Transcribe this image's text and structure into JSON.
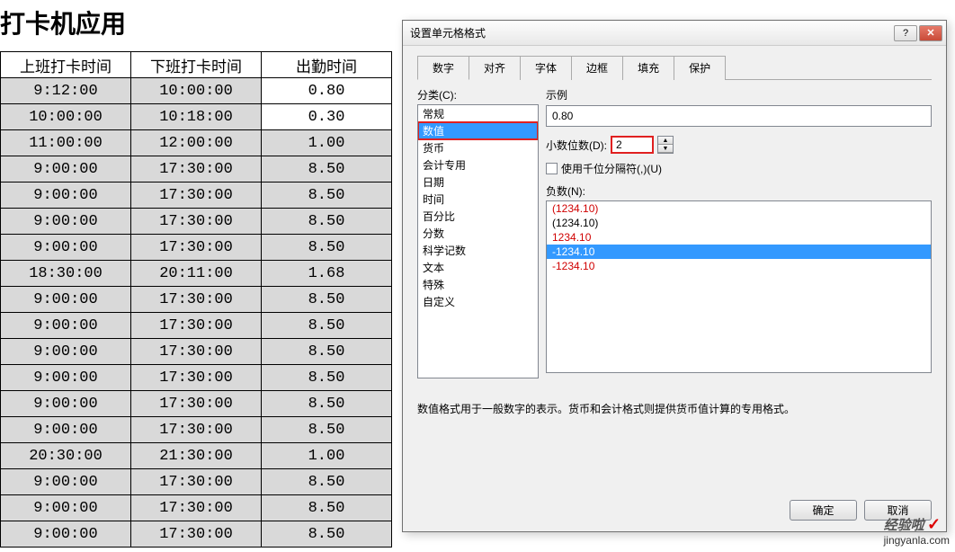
{
  "title": "打卡机应用",
  "table": {
    "headers": [
      "上班打卡时间",
      "下班打卡时间",
      "出勤时间"
    ],
    "rows": [
      [
        "9:12:00",
        "10:00:00",
        "0.80"
      ],
      [
        "10:00:00",
        "10:18:00",
        "0.30"
      ],
      [
        "11:00:00",
        "12:00:00",
        "1.00"
      ],
      [
        "9:00:00",
        "17:30:00",
        "8.50"
      ],
      [
        "9:00:00",
        "17:30:00",
        "8.50"
      ],
      [
        "9:00:00",
        "17:30:00",
        "8.50"
      ],
      [
        "9:00:00",
        "17:30:00",
        "8.50"
      ],
      [
        "18:30:00",
        "20:11:00",
        "1.68"
      ],
      [
        "9:00:00",
        "17:30:00",
        "8.50"
      ],
      [
        "9:00:00",
        "17:30:00",
        "8.50"
      ],
      [
        "9:00:00",
        "17:30:00",
        "8.50"
      ],
      [
        "9:00:00",
        "17:30:00",
        "8.50"
      ],
      [
        "9:00:00",
        "17:30:00",
        "8.50"
      ],
      [
        "9:00:00",
        "17:30:00",
        "8.50"
      ],
      [
        "20:30:00",
        "21:30:00",
        "1.00"
      ],
      [
        "9:00:00",
        "17:30:00",
        "8.50"
      ],
      [
        "9:00:00",
        "17:30:00",
        "8.50"
      ],
      [
        "9:00:00",
        "17:30:00",
        "8.50"
      ]
    ]
  },
  "dialog": {
    "title": "设置单元格格式",
    "help_symbol": "?",
    "close_symbol": "✕",
    "tabs": [
      "数字",
      "对齐",
      "字体",
      "边框",
      "填充",
      "保护"
    ],
    "active_tab_idx": 0,
    "category_label": "分类(C):",
    "categories": [
      "常规",
      "数值",
      "货币",
      "会计专用",
      "日期",
      "时间",
      "百分比",
      "分数",
      "科学记数",
      "文本",
      "特殊",
      "自定义"
    ],
    "selected_category_idx": 1,
    "example_label": "示例",
    "example_value": "0.80",
    "decimal_label": "小数位数(D):",
    "decimal_value": "2",
    "thousands_label": "使用千位分隔符(,)(U)",
    "negative_label": "负数(N):",
    "negatives": [
      {
        "text": "(1234.10)",
        "red": true
      },
      {
        "text": "(1234.10)",
        "red": false
      },
      {
        "text": "1234.10",
        "red": true
      },
      {
        "text": "-1234.10",
        "red": false,
        "selected": true
      },
      {
        "text": "-1234.10",
        "red": true
      }
    ],
    "description": "数值格式用于一般数字的表示。货币和会计格式则提供货币值计算的专用格式。",
    "ok_label": "确定",
    "cancel_label": "取消"
  },
  "watermark": {
    "brand": "经验啦",
    "url": "jingyanla.com"
  }
}
